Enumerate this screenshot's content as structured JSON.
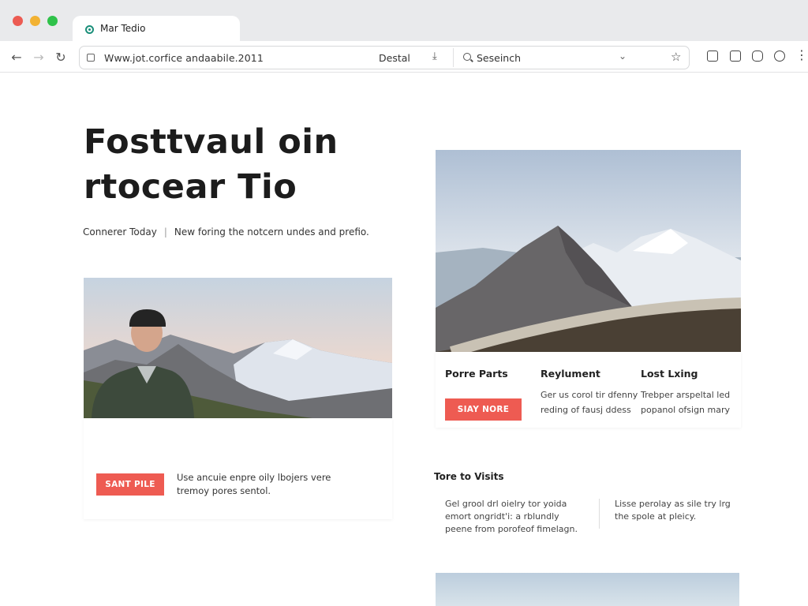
{
  "browser": {
    "tab_title": "Mar Tedio",
    "url": "Www.jot.corfice andaabile.2011",
    "url_mid": "Destal",
    "search_placeholder": "Seseinch"
  },
  "hero": {
    "title_line1": "Fosttvaul oin",
    "title_line2": "rtocear Tio",
    "subtitle_left": "Connerer Today",
    "subtitle_sep": "|",
    "subtitle_right": "New foring the notcern undes and prefio."
  },
  "left_card": {
    "button_label": "SANT PILE",
    "text": "Use ancuie enpre oily lbojers vere tremoy pores sentol."
  },
  "features": [
    {
      "title": "Porre Parts",
      "desc": ""
    },
    {
      "title": "Reylument",
      "desc": "Ger us corol tir dfenny reding of fausj ddess"
    },
    {
      "title": "Lost Lxing",
      "desc": "Trebper arspeltal led popanol ofsign mary"
    }
  ],
  "features_button": "SIAY NORE",
  "visit": {
    "title": "Tore to Visits",
    "col1": "Gel grool drl oielry tor yoida emort ongridt'i: a rblundly peene from porofeof fimelagn.",
    "col2": "Lisse perolay as sile try lrg the spole at pleicy."
  },
  "colors": {
    "accent": "#ee5b52",
    "chrome": "#e9eaec"
  },
  "icons": [
    "back-icon",
    "forward-icon",
    "reload-icon",
    "lock-icon",
    "download-icon",
    "search-icon",
    "chevron-down-icon",
    "star-icon",
    "extension-icon",
    "menu-icon"
  ]
}
